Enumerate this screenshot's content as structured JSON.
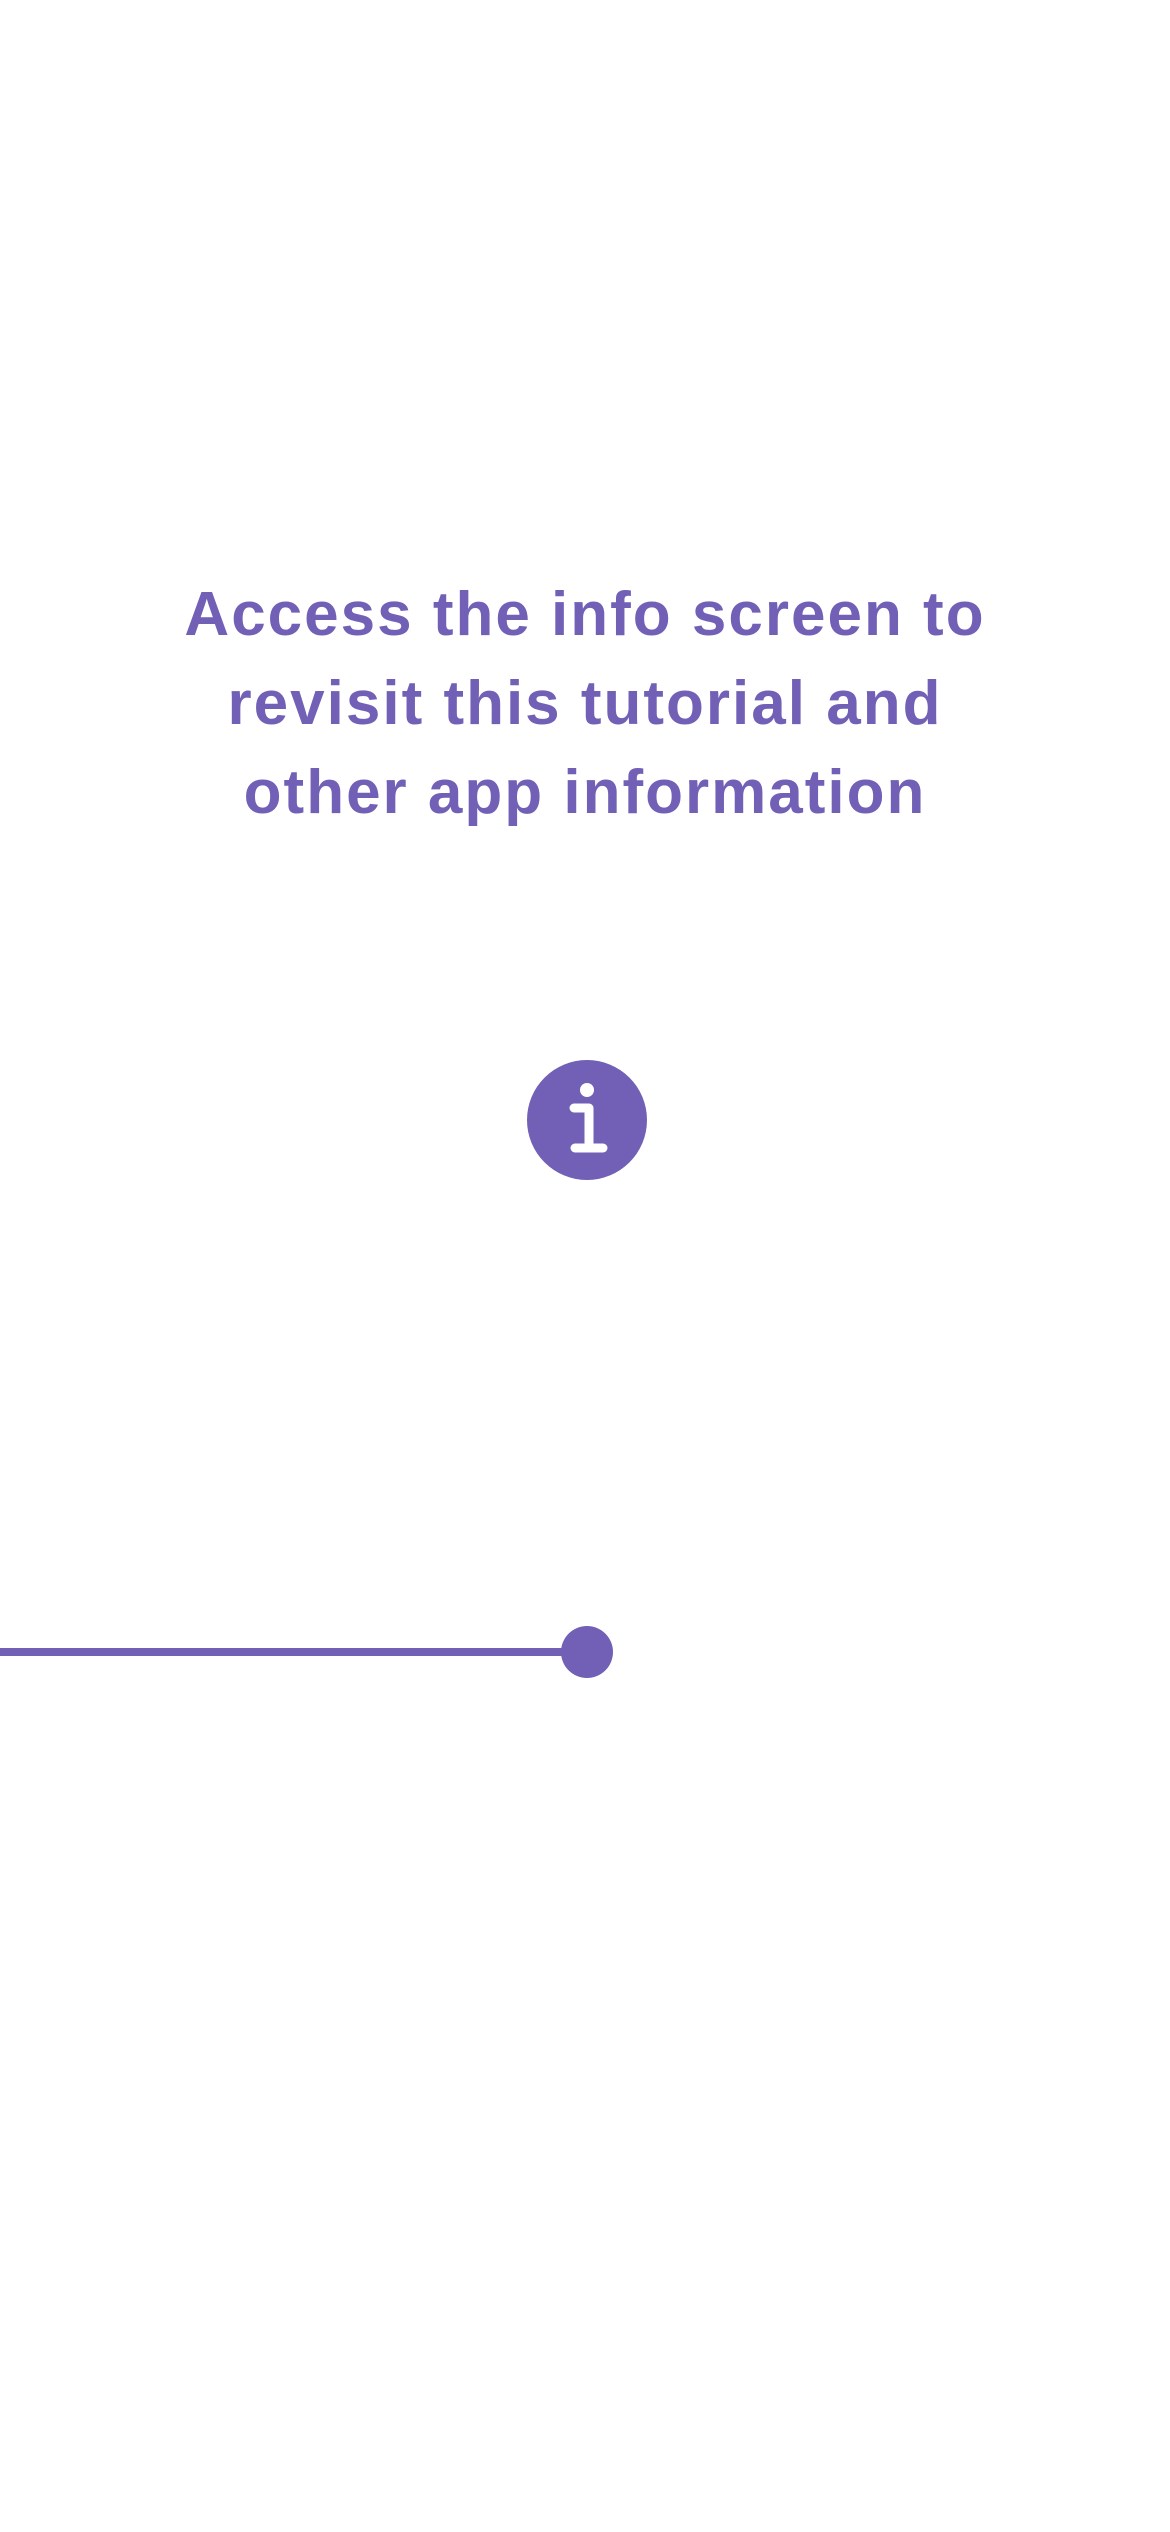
{
  "tutorial": {
    "message_lines": [
      "Access the info screen to",
      "revisit this tutorial and",
      "other app information"
    ],
    "icon": "info-icon",
    "progress_percent": 50
  },
  "colors": {
    "accent": "#7160b6",
    "background": "#ffffff"
  }
}
